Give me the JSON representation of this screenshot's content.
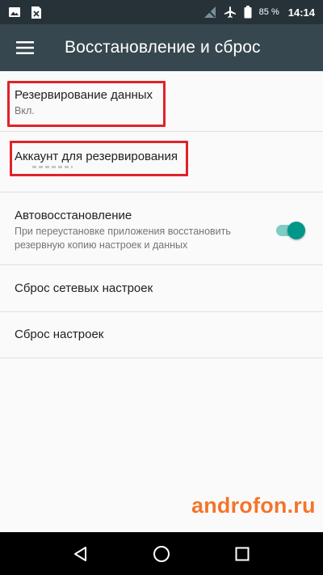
{
  "status_bar": {
    "battery_percent": "85 %",
    "time": "14:14",
    "icons": [
      "image-icon",
      "sim-card-icon",
      "no-signal-icon",
      "airplane-icon",
      "battery-icon"
    ]
  },
  "app_bar": {
    "title": "Восстановление и сброс",
    "menu_icon": "hamburger-menu-icon"
  },
  "settings": {
    "backup": {
      "title": "Резервирование данных",
      "summary": "Вкл."
    },
    "backup_account": {
      "title": "Аккаунт для резервирования"
    },
    "auto_restore": {
      "title": "Автовосстановление",
      "summary": "При переустановке приложения восстановить резервную копию настроек и данных",
      "enabled": true
    },
    "network_reset": {
      "title": "Сброс сетевых настроек"
    },
    "factory_reset": {
      "title": "Сброс настроек"
    }
  },
  "watermark": "androfon.ru",
  "nav_bar": {
    "icons": [
      "back-triangle-icon",
      "home-circle-icon",
      "recents-square-icon"
    ]
  },
  "colors": {
    "status_bar": "#263238",
    "app_bar": "#37474f",
    "accent": "#009688",
    "highlight": "#e0222b",
    "watermark": "#f4742b"
  }
}
